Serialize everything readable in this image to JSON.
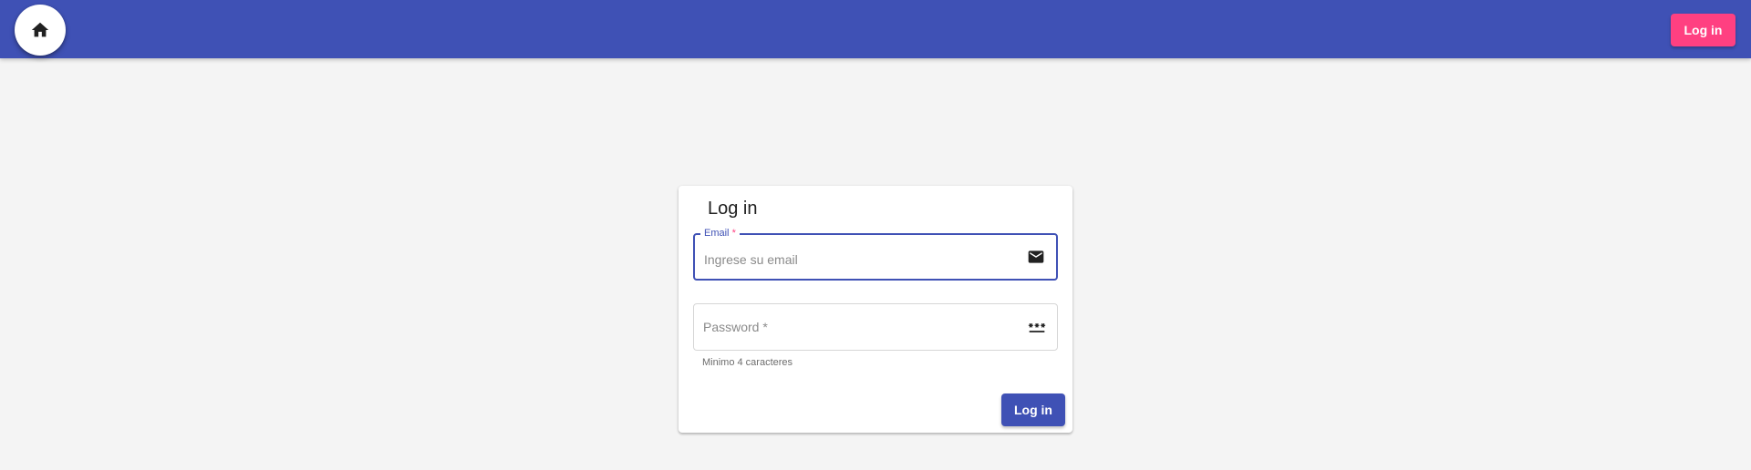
{
  "colors": {
    "primary": "#3f51b5",
    "accent": "#ff4081",
    "background": "#f4f4f4",
    "card": "#ffffff"
  },
  "header": {
    "home_icon": "home-icon",
    "login_button": "Log in"
  },
  "login_card": {
    "title": "Log in",
    "email": {
      "label": "Email",
      "required_mark": "*",
      "placeholder": "Ingrese su email",
      "value": "",
      "icon": "mail-icon"
    },
    "password": {
      "placeholder": "Password *",
      "value": "",
      "helper": "Minimo 4 caracteres",
      "icon": "password-icon"
    },
    "submit_button": "Log in"
  }
}
